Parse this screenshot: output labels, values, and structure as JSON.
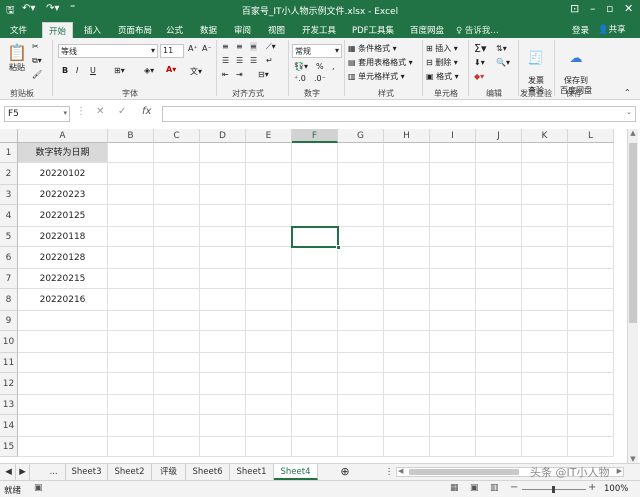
{
  "app": {
    "title": "百家号_IT小人物示例文件.xlsx - Excel",
    "login": "登录",
    "share": "共享",
    "tell_me": "♀ 告诉我..."
  },
  "colors": {
    "accent": "#217346",
    "header_cell_fill": "#d9d9d9"
  },
  "quick_access": {
    "save_icon": "save-icon",
    "undo_icon": "undo-icon",
    "redo_icon": "redo-icon",
    "customize_icon": "customize-icon"
  },
  "ribbon_tabs": [
    "文件",
    "开始",
    "插入",
    "页面布局",
    "公式",
    "数据",
    "审阅",
    "视图",
    "开发工具",
    "PDF工具集",
    "百度网盘"
  ],
  "active_tab_index": 1,
  "ribbon": {
    "clipboard": {
      "paste": "粘贴",
      "label": "剪贴板"
    },
    "font": {
      "name": "等线",
      "size": "11",
      "label": "字体",
      "bold": "B",
      "italic": "I",
      "underline": "U"
    },
    "alignment": {
      "label": "对齐方式"
    },
    "number": {
      "format": "常规",
      "label": "数字",
      "percent": "%"
    },
    "styles": {
      "conditional": "条件格式",
      "table": "套用表格格式",
      "cell": "单元格样式",
      "label": "样式"
    },
    "cells": {
      "insert": "插入",
      "delete": "删除",
      "format": "格式",
      "label": "单元格"
    },
    "editing": {
      "label": "编辑"
    },
    "invoice": {
      "button": "发票\n查验",
      "label": "发票查验"
    },
    "save": {
      "button": "保存到\n百度网盘",
      "label": "保存"
    }
  },
  "formula_bar": {
    "name_box": "F5",
    "cancel": "✕",
    "enter": "✓",
    "fx": "fx",
    "value": ""
  },
  "columns": [
    "A",
    "B",
    "C",
    "D",
    "E",
    "F",
    "G",
    "H",
    "I",
    "J",
    "K",
    "L"
  ],
  "selected_column": "F",
  "rows": [
    "1",
    "2",
    "3",
    "4",
    "5",
    "6",
    "7",
    "8",
    "9",
    "10",
    "11",
    "12",
    "13",
    "14",
    "15"
  ],
  "selected_row": "5",
  "cells": {
    "A1": "数字转为日期",
    "A2": "20220102",
    "A3": "20220223",
    "A4": "20220125",
    "A5": "20220118",
    "A6": "20220128",
    "A7": "20220215",
    "A8": "20220216"
  },
  "sheet_tabs": [
    "...",
    "Sheet3",
    "Sheet2",
    "评级",
    "Sheet6",
    "Sheet1",
    "Sheet4"
  ],
  "active_sheet": "Sheet4",
  "status": {
    "mode": "就绪",
    "zoom": "100%"
  },
  "watermark": "头条 @IT小人物"
}
